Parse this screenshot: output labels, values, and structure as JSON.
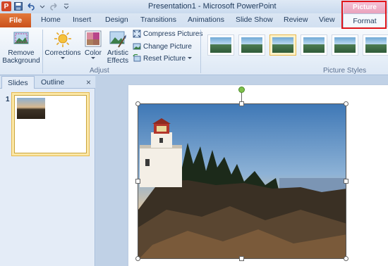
{
  "window": {
    "title": "Presentation1 - Microsoft PowerPoint"
  },
  "context_group": {
    "label": "Picture Tools"
  },
  "tabs": [
    {
      "id": "file",
      "label": "File"
    },
    {
      "id": "home",
      "label": "Home"
    },
    {
      "id": "insert",
      "label": "Insert"
    },
    {
      "id": "design",
      "label": "Design"
    },
    {
      "id": "transitions",
      "label": "Transitions"
    },
    {
      "id": "animations",
      "label": "Animations"
    },
    {
      "id": "slideshow",
      "label": "Slide Show"
    },
    {
      "id": "review",
      "label": "Review"
    },
    {
      "id": "view",
      "label": "View"
    },
    {
      "id": "format",
      "label": "Format"
    }
  ],
  "ribbon": {
    "remove_bg": {
      "line1": "Remove",
      "line2": "Background"
    },
    "corrections": "Corrections",
    "color": "Color",
    "artistic": {
      "line1": "Artistic",
      "line2": "Effects"
    },
    "compress": "Compress Pictures",
    "change": "Change Picture",
    "reset": "Reset Picture",
    "adjust_label": "Adjust",
    "picture_styles_label": "Picture Styles"
  },
  "panel": {
    "tab_slides": "Slides",
    "tab_outline": "Outline",
    "close": "×",
    "slide_number": "1"
  },
  "colors": {
    "file_tab": "#c9501b",
    "context_tab": "#e9a2bd",
    "highlight_box": "#e0151b",
    "rotate_handle": "#7ec04a"
  },
  "icons": {
    "app": "powerpoint-icon",
    "save": "save-icon",
    "undo": "undo-icon",
    "redo": "redo-icon"
  }
}
